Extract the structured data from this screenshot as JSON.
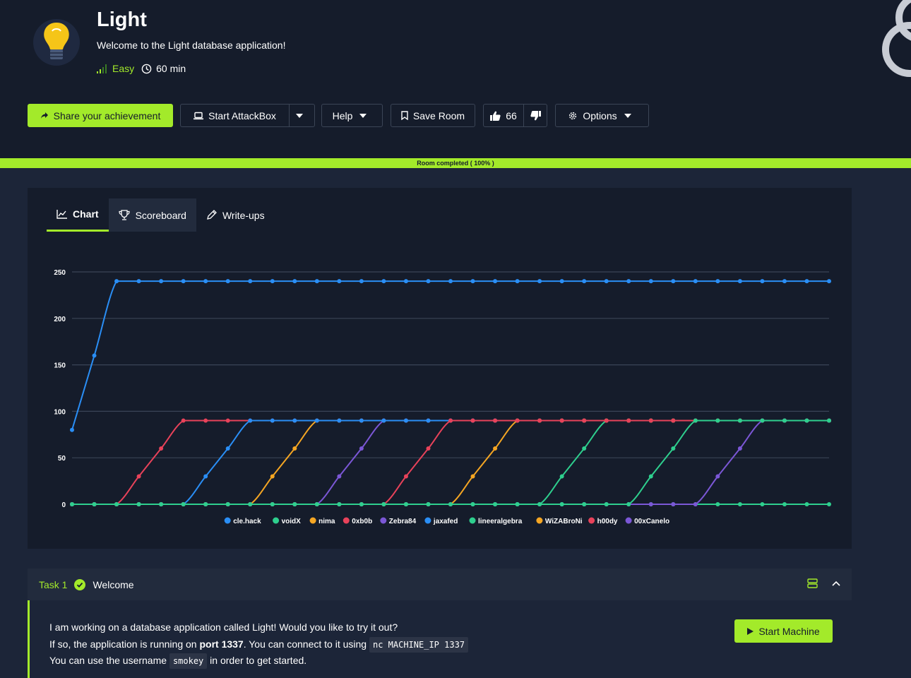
{
  "room": {
    "title": "Light",
    "description": "Welcome to the Light database application!",
    "difficulty": "Easy",
    "duration": "60 min"
  },
  "actions": {
    "share": "Share your achievement",
    "attackbox": "Start AttackBox",
    "help": "Help",
    "save": "Save Room",
    "likes": "66",
    "options": "Options"
  },
  "progress": {
    "label": "Room completed ( 100% )",
    "value": 100
  },
  "tabs": [
    "Chart",
    "Scoreboard",
    "Write-ups"
  ],
  "chart_data": {
    "type": "line",
    "ylim": [
      0,
      250
    ],
    "yticks": [
      0,
      50,
      100,
      150,
      200,
      250
    ],
    "grid": true,
    "legend_position": "bottom",
    "series": [
      {
        "name": "cle.hack",
        "color": "#2a8ef5",
        "values": [
          80,
          160,
          240,
          240,
          240,
          240,
          240,
          240,
          240,
          240,
          240,
          240,
          240,
          240,
          240,
          240,
          240,
          240,
          240,
          240,
          240,
          240,
          240,
          240,
          240,
          240,
          240,
          240,
          240,
          240,
          240,
          240,
          240,
          240,
          240
        ]
      },
      {
        "name": "voidX",
        "color": "#2ecf8e",
        "values": [
          0,
          0,
          0,
          0,
          0,
          0,
          0,
          0,
          0,
          0,
          0,
          0,
          0,
          0,
          0,
          0,
          0,
          0,
          0,
          0,
          0,
          0,
          0,
          0,
          0,
          0,
          0,
          0,
          0,
          0,
          0,
          0,
          0,
          0,
          0
        ]
      },
      {
        "name": "nima",
        "color": "#f5a623",
        "values": [
          0,
          0,
          0,
          0,
          0,
          0,
          0,
          0,
          0,
          30,
          60,
          90,
          90,
          90,
          90,
          90,
          90,
          90,
          90,
          90,
          90,
          90,
          90,
          90,
          90,
          90,
          90,
          90,
          90,
          90,
          90,
          90,
          90,
          90,
          90
        ]
      },
      {
        "name": "0xb0b",
        "color": "#e8425a",
        "values": [
          0,
          0,
          0,
          30,
          60,
          90,
          90,
          90,
          90,
          90,
          90,
          90,
          90,
          90,
          90,
          90,
          90,
          90,
          90,
          90,
          90,
          90,
          90,
          90,
          90,
          90,
          90,
          90,
          90,
          90,
          90,
          90,
          90,
          90,
          90
        ]
      },
      {
        "name": "Zebra84",
        "color": "#7b57d6",
        "values": [
          0,
          0,
          0,
          0,
          0,
          0,
          0,
          0,
          0,
          0,
          0,
          0,
          30,
          60,
          90,
          90,
          90,
          90,
          90,
          90,
          90,
          90,
          90,
          90,
          90,
          90,
          90,
          90,
          90,
          90,
          90,
          90,
          90,
          90,
          90
        ]
      },
      {
        "name": "jaxafed",
        "color": "#2a8ef5",
        "values": [
          0,
          0,
          0,
          0,
          0,
          0,
          30,
          60,
          90,
          90,
          90,
          90,
          90,
          90,
          90,
          90,
          90,
          90,
          90,
          90,
          90,
          90,
          90,
          90,
          90,
          90,
          90,
          90,
          90,
          90,
          90,
          90,
          90,
          90,
          90
        ]
      },
      {
        "name": "lineeralgebra",
        "color": "#2ecf8e",
        "values": [
          0,
          0,
          0,
          0,
          0,
          0,
          0,
          0,
          0,
          0,
          0,
          0,
          0,
          0,
          0,
          0,
          0,
          0,
          0,
          0,
          0,
          0,
          30,
          60,
          90,
          90,
          90,
          90,
          90,
          90,
          90,
          90,
          90,
          90,
          90
        ]
      },
      {
        "name": "WiZABroNi",
        "color": "#f5a623",
        "values": [
          0,
          0,
          0,
          0,
          0,
          0,
          0,
          0,
          0,
          0,
          0,
          0,
          0,
          0,
          0,
          0,
          0,
          0,
          30,
          60,
          90,
          90,
          90,
          90,
          90,
          90,
          90,
          90,
          90,
          90,
          90,
          90,
          90,
          90,
          90
        ]
      },
      {
        "name": "h00dy",
        "color": "#e8425a",
        "values": [
          0,
          0,
          0,
          0,
          0,
          0,
          0,
          0,
          0,
          0,
          0,
          0,
          0,
          0,
          0,
          30,
          60,
          90,
          90,
          90,
          90,
          90,
          90,
          90,
          90,
          90,
          90,
          90,
          90,
          90,
          90,
          90,
          90,
          90,
          90
        ]
      },
      {
        "name": "00xCanelo",
        "color": "#7b57d6",
        "values": [
          0,
          0,
          0,
          0,
          0,
          0,
          0,
          0,
          0,
          0,
          0,
          0,
          0,
          0,
          0,
          0,
          0,
          0,
          0,
          0,
          0,
          0,
          0,
          0,
          0,
          0,
          0,
          0,
          0,
          30,
          60,
          90,
          90,
          90,
          90
        ]
      },
      {
        "name": "",
        "color": "#2ecf8e",
        "values": [
          0,
          0,
          0,
          0,
          0,
          0,
          0,
          0,
          0,
          0,
          0,
          0,
          0,
          0,
          0,
          0,
          0,
          0,
          0,
          0,
          0,
          0,
          0,
          0,
          0,
          0,
          30,
          60,
          90,
          90,
          90,
          90,
          90,
          90,
          90
        ]
      }
    ]
  },
  "task": {
    "number": "Task 1",
    "title": "Welcome",
    "line1": "I am working on a database application called Light! Would you like to try it out?",
    "line2_pre": "If so, the application is running on ",
    "line2_bold": "port 1337",
    "line2_mid": ". You can connect to it using ",
    "line2_code": "nc MACHINE_IP 1337",
    "line3_pre": "You can use the username ",
    "line3_code": "smokey",
    "line3_post": " in order to get started.",
    "start_machine": "Start Machine"
  },
  "icons": {
    "share": "share-icon",
    "laptop": "laptop-icon",
    "bookmark": "bookmark-icon",
    "thumbs_up": "thumbs-up-icon",
    "thumbs_down": "thumbs-down-icon",
    "gear": "gear-icon",
    "chart": "chart-line-icon",
    "trophy": "trophy-icon",
    "pencil": "pencil-icon",
    "clock": "clock-icon",
    "signal": "signal-icon",
    "check": "check-circle-icon",
    "server": "server-icon",
    "chevron": "chevron-up-icon",
    "play": "play-icon"
  },
  "colors": {
    "accent": "#a3ea2a",
    "bg": "#1c2538",
    "panel": "#151c2b"
  }
}
